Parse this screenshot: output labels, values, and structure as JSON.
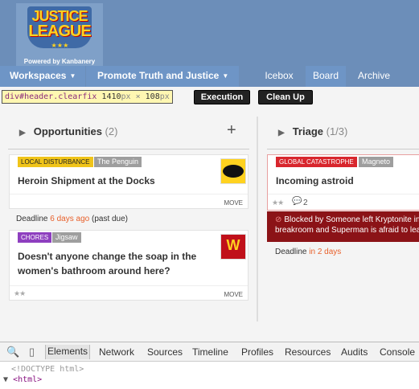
{
  "header": {
    "logo_line1": "JUSTICE",
    "logo_line2": "LEAGUE",
    "logo_stars": "★ ★ ★",
    "powered_by": "Powered by Kanbanery",
    "nav": {
      "workspaces": "Workspaces",
      "project": "Promote Truth and Justice",
      "icebox": "Icebox",
      "board": "Board",
      "archive": "Archive"
    }
  },
  "inspector": {
    "selector": "div#header.clearfix",
    "width": "1410",
    "height": "108",
    "unit": "px",
    "times": "×"
  },
  "toolbar": {
    "execution": "Execution",
    "clean_up": "Clean Up"
  },
  "columns": [
    {
      "title": "Opportunities",
      "count": "(2)"
    },
    {
      "title": "Triage",
      "count": "(1/3)"
    }
  ],
  "cards": [
    {
      "tag": "LOCAL DISTURBANCE",
      "owner": "The Penguin",
      "title": "Heroin Shipment at the Docks",
      "move": "MOVE",
      "deadline_label": "Deadline",
      "deadline_value": "6 days ago",
      "deadline_note": "(past due)",
      "avatar": "batman-icon"
    },
    {
      "tag": "CHORES",
      "owner": "Jigsaw",
      "title_line1": "Doesn't anyone change the soap in the",
      "title_line2": "women's bathroom around here?",
      "stars": "★★",
      "move": "MOVE",
      "avatar": "wonder-woman-icon"
    },
    {
      "tag": "GLOBAL CATASTROPHE",
      "owner": "Magneto",
      "title": "Incoming astroid",
      "stars": "★★",
      "comments": "2",
      "blocked_line1": "Blocked by Someone left Kryptonite in",
      "blocked_line2": "breakroom and Superman is afraid to lea",
      "deadline_label": "Deadline",
      "deadline_value": "in 2 days"
    }
  ],
  "devtools": {
    "tabs": [
      "Elements",
      "Network",
      "Sources",
      "Timeline",
      "Profiles",
      "Resources",
      "Audits",
      "Console"
    ],
    "active_tab": "Elements",
    "line1": "<!DOCTYPE html>",
    "line2": "<html>"
  },
  "colors": {
    "header_bg": "#5e7fa6",
    "tag_local": "#f0c419",
    "tag_chores": "#8e3fbf",
    "tag_global": "#d8262d",
    "blocked_bg": "#8b1317",
    "late": "#e8612c"
  }
}
